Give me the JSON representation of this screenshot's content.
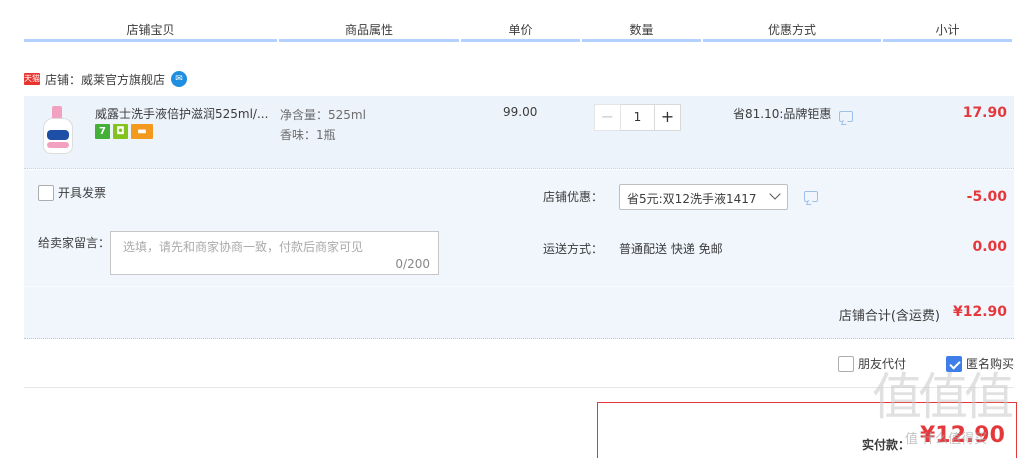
{
  "columns": [
    {
      "label": "店铺宝贝",
      "w": 253
    },
    {
      "label": "商品属性",
      "w": 180
    },
    {
      "label": "单价",
      "w": 119
    },
    {
      "label": "数量",
      "w": 119
    },
    {
      "label": "优惠方式",
      "w": 178
    },
    {
      "label": "小计",
      "w": 129
    }
  ],
  "shop": {
    "badge": "天猫",
    "label": "店铺：威莱官方旗舰店"
  },
  "item": {
    "title": "威露士洗手液倍护滋润525ml/...",
    "property_volume": "净含量：525ml",
    "property_scent": "香味：1瓶",
    "unit_price": "99.00",
    "quantity": "1",
    "qty_minus": "−",
    "qty_plus": "+",
    "discount": "省81.10:品牌钜惠",
    "subtotal": "17.90",
    "icon_7": "7",
    "icon_shield": "◘",
    "icon_card": "▬"
  },
  "options": {
    "invoice_label": "开具发票",
    "message_label": "给卖家留言：",
    "message_placeholder": "选填，请先和商家协商一致，付款后商家可见",
    "message_count": "0/200",
    "shop_discount_label": "店铺优惠：",
    "shop_discount_selected": "省5元:双12洗手液1417",
    "shop_discount_amount": "-5.00",
    "shipping_label": "运送方式：",
    "shipping_value": "普通配送 快递 免邮",
    "shipping_amount": "0.00"
  },
  "shop_total": {
    "label": "店铺合计(含运费)",
    "value": "¥12.90"
  },
  "pay_options": {
    "friend_pay": "朋友代付",
    "anonymous": "匿名购买"
  },
  "actual_pay": {
    "label": "实付款：",
    "value": "¥12.90"
  },
  "watermark": {
    "text": "值值值",
    "sub": "值 什么值得买"
  },
  "colors": {
    "price_red": "#e4393c",
    "header_line": "#b2d1ff",
    "row_bg": "#edf3fb",
    "check_blue": "#3d7ee8"
  }
}
